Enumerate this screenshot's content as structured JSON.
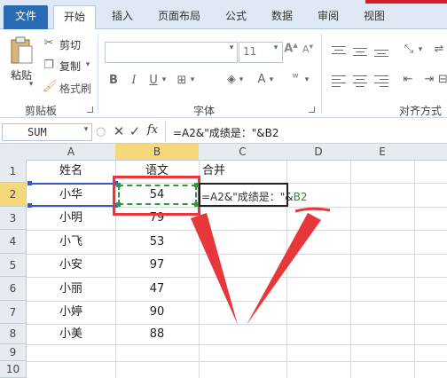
{
  "ribbon_tabs": [
    "文件",
    "开始",
    "插入",
    "页面布局",
    "公式",
    "数据",
    "审阅",
    "视图"
  ],
  "clipboard": {
    "paste": "粘贴",
    "cut": "剪切",
    "copy": "复制",
    "format_painter": "格式刷",
    "group_label": "剪贴板"
  },
  "font": {
    "size": "11",
    "group_label": "字体"
  },
  "alignment": {
    "group_label": "对齐方式"
  },
  "formula_bar": {
    "name_box": "SUM",
    "fx": "fx",
    "formula": "=A2&\"成绩是：\"&B2"
  },
  "columns": [
    "A",
    "B",
    "C",
    "D",
    "E"
  ],
  "rows": [
    "1",
    "2",
    "3",
    "4",
    "5",
    "6",
    "7",
    "8",
    "9",
    "10"
  ],
  "sheet": {
    "header": {
      "a": "姓名",
      "b": "语文",
      "c": "合并"
    },
    "data": [
      {
        "a": "小华",
        "b": "54"
      },
      {
        "a": "小明",
        "b": "79"
      },
      {
        "a": "小飞",
        "b": "53"
      },
      {
        "a": "小安",
        "b": "97"
      },
      {
        "a": "小丽",
        "b": "47"
      },
      {
        "a": "小婷",
        "b": "90"
      },
      {
        "a": "小美",
        "b": "88"
      }
    ],
    "edit_cell": {
      "prefix": "=A2&\"成绩是：\"&",
      "ref": "B2"
    }
  },
  "colors": {
    "accent": "#2b6ab5",
    "annotation": "#e8373a",
    "selection": "#2c9a3d",
    "ref_green": "#2a8a2a"
  }
}
